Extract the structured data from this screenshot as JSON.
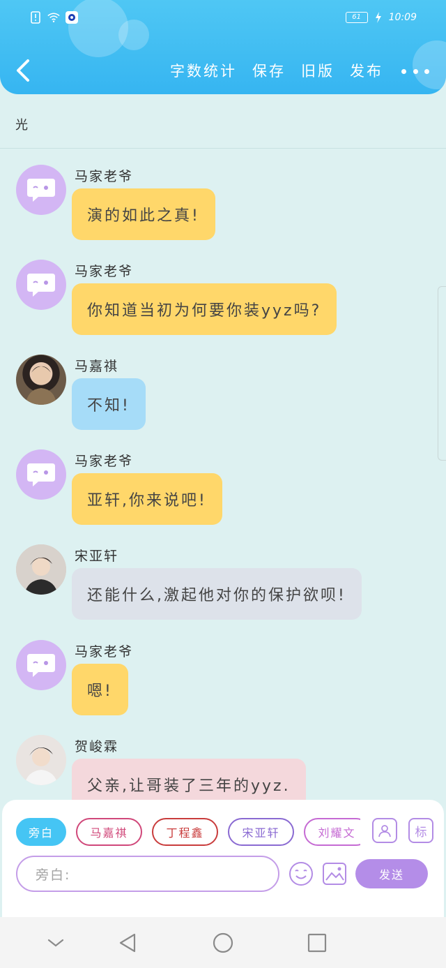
{
  "status_bar": {
    "battery": "61",
    "time": "10:09"
  },
  "nav": {
    "items": [
      "字数统计",
      "保存",
      "旧版",
      "发布"
    ]
  },
  "story": {
    "title": "光"
  },
  "messages": [
    {
      "name": "马家老爷",
      "text": "演的如此之真!",
      "avatar": "narrator-chat-icon",
      "color": "#ffd76a"
    },
    {
      "name": "马家老爷",
      "text": "你知道当初为何要你装yyz吗?",
      "avatar": "narrator-chat-icon",
      "color": "#ffd76a"
    },
    {
      "name": "马嘉祺",
      "text": "不知!",
      "avatar": "user-photo",
      "color": "#a6dcf8"
    },
    {
      "name": "马家老爷",
      "text": "亚轩,你来说吧!",
      "avatar": "narrator-chat-icon",
      "color": "#ffd76a"
    },
    {
      "name": "宋亚轩",
      "text": "还能什么,激起他对你的保护欲呗!",
      "avatar": "user-photo",
      "color": "#dde2ea"
    },
    {
      "name": "马家老爷",
      "text": "嗯!",
      "avatar": "narrator-chat-icon",
      "color": "#ffd76a"
    },
    {
      "name": "贺峻霖",
      "text": "父亲,让哥装了三年的yyz.",
      "avatar": "user-photo",
      "color": "#f4d8dc"
    }
  ],
  "composer": {
    "chips": [
      "旁白",
      "马嘉祺",
      "丁程鑫",
      "宋亚轩",
      "刘耀文"
    ],
    "tag_label": "标",
    "placeholder": "旁白:",
    "send_label": "发送"
  }
}
